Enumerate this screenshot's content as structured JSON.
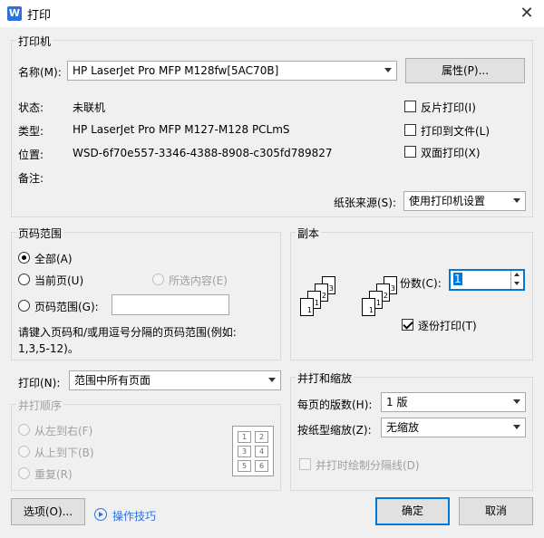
{
  "window": {
    "title": "打印",
    "app_icon_letter": "W",
    "close_glyph": "✕"
  },
  "printer": {
    "group_title": "打印机",
    "name_label": "名称(M):",
    "name_value": "HP LaserJet Pro MFP M128fw[5AC70B]",
    "properties_button": "属性(P)...",
    "status_label": "状态:",
    "status_value": "未联机",
    "type_label": "类型:",
    "type_value": "HP LaserJet Pro MFP M127-M128 PCLmS",
    "location_label": "位置:",
    "location_value": "WSD-6f70e557-3346-4388-8908-c305fd789827",
    "comment_label": "备注:",
    "reverse_print": "反片打印(I)",
    "print_to_file": "打印到文件(L)",
    "duplex": "双面打印(X)",
    "paper_source_label": "纸张来源(S):",
    "paper_source_value": "使用打印机设置"
  },
  "page_range": {
    "group_title": "页码范围",
    "all": "全部(A)",
    "current": "当前页(U)",
    "selection": "所选内容(E)",
    "pages": "页码范围(G):",
    "pages_value": "",
    "hint_line1": "请键入页码和/或用逗号分隔的页码范围(例如:",
    "hint_line2": "1,3,5-12)。"
  },
  "copies": {
    "group_title": "副本",
    "count_label": "份数(C):",
    "count_value": "1",
    "collate": "逐份打印(T)"
  },
  "print_what": {
    "label": "打印(N):",
    "value": "范围中所有页面"
  },
  "order": {
    "group_title": "并打顺序",
    "left_to_right": "从左到右(F)",
    "top_to_bottom": "从上到下(B)",
    "repeat": "重复(R)"
  },
  "zoom": {
    "group_title": "并打和缩放",
    "pages_per_sheet_label": "每页的版数(H):",
    "pages_per_sheet_value": "1 版",
    "scale_label": "按纸型缩放(Z):",
    "scale_value": "无缩放",
    "draw_lines": "并打时绘制分隔线(D)"
  },
  "footer": {
    "options_button": "选项(O)...",
    "tips_link": "操作技巧",
    "ok_button": "确定",
    "cancel_button": "取消"
  }
}
